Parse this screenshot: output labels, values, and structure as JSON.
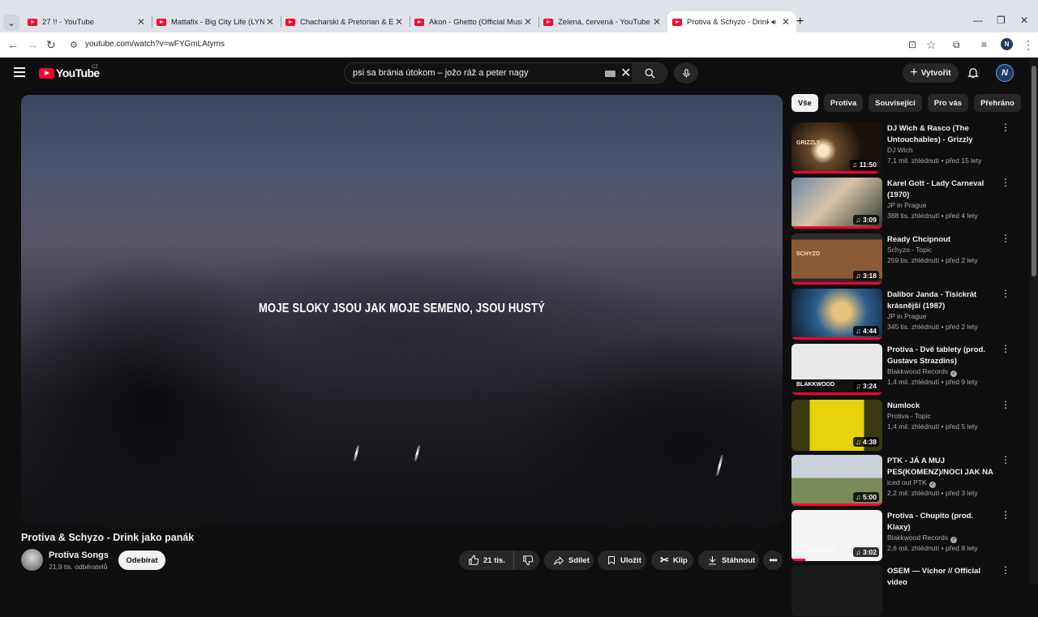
{
  "browser": {
    "tabs": [
      {
        "title": "27 !! - YouTube",
        "active": false,
        "audio": false
      },
      {
        "title": "Mattafix - Big City Life (LYNE Dr",
        "active": false,
        "audio": false
      },
      {
        "title": "Chacharski & Pretorian & El Ba",
        "active": false,
        "audio": false
      },
      {
        "title": "Akon - Ghetto (Official Music V",
        "active": false,
        "audio": false
      },
      {
        "title": "Zelená, červená - YouTube",
        "active": false,
        "audio": false
      },
      {
        "title": "Protiva & Schyzo - Drink jak",
        "active": true,
        "audio": true
      }
    ],
    "url": "youtube.com/watch?v=wFYGmLAtyms"
  },
  "masthead": {
    "logo_text": "YouTube",
    "country_code": "CZ",
    "search_value": "psi sa bránia útokom – jožo ráž a peter nagy",
    "create_label": "Vytvořit",
    "avatar_letter": "N"
  },
  "player": {
    "subtitle": "MOJE SLOKY JSOU JAK MOJE SEMENO, JSOU HUSTÝ"
  },
  "video": {
    "title": "Protiva & Schyzo - Drink jako panák",
    "channel": "Protiva Songs",
    "subscribers": "21,9 tis. odběratelů",
    "subscribe_label": "Odebírat",
    "likes": "21 tis.",
    "share_label": "Sdílet",
    "save_label": "Uložit",
    "clip_label": "Klip",
    "download_label": "Stáhnout"
  },
  "chips": [
    "Vše",
    "Protiva",
    "Související",
    "Pro vás",
    "Přehráno"
  ],
  "recommendations": [
    {
      "title": "DJ Wich & Rasco (The Untouchables) - Grizzly (CZ/S...",
      "channel": "DJ Wich",
      "verified": false,
      "views": "7,1 mil. zhlédnutí",
      "age": "před 15 lety",
      "duration": "11:50",
      "progress": 0.95,
      "thumb_text": "GRIZZLY"
    },
    {
      "title": "Karel Gott - Lady Carneval (1970)",
      "channel": "JP in Prague",
      "verified": false,
      "views": "388 tis. zhlédnutí",
      "age": "před 4 lety",
      "duration": "3:09",
      "progress": 1.0,
      "thumb_text": ""
    },
    {
      "title": "Ready Chcipnout",
      "channel": "Schyzo - Topic",
      "verified": false,
      "views": "259 tis. zhlédnutí",
      "age": "před 2 lety",
      "duration": "3:18",
      "progress": 1.0,
      "thumb_text": "SCHYZO"
    },
    {
      "title": "Dalibor Janda - Tisíckrát krásnější (1987)",
      "channel": "JP in Prague",
      "verified": false,
      "views": "345 tis. zhlédnutí",
      "age": "před 2 lety",
      "duration": "4:44",
      "progress": 1.0,
      "thumb_text": ""
    },
    {
      "title": "Protiva - Dvě tablety (prod. Gustavs Strazdins)",
      "channel": "Blakkwood Records",
      "verified": true,
      "views": "1,4 mil. zhlédnutí",
      "age": "před 9 lety",
      "duration": "3:24",
      "progress": 1.0,
      "thumb_text": "BLAKKWOOD"
    },
    {
      "title": "Numlock",
      "channel": "Protiva - Topic",
      "verified": false,
      "views": "1,4 mil. zhlédnutí",
      "age": "před 5 lety",
      "duration": "4:38",
      "progress": 0,
      "thumb_text": ""
    },
    {
      "title": "PTK - JÁ A MUJ PES(KOMENZ)/NOCI JAK NA ...",
      "channel": "iced out PTK",
      "verified": true,
      "views": "2,2 mil. zhlédnutí",
      "age": "před 3 lety",
      "duration": "5:00",
      "progress": 1.0,
      "thumb_text": ""
    },
    {
      "title": "Protiva - Chupito (prod. Klaxy)",
      "channel": "Blakkwood Records",
      "verified": true,
      "views": "2,6 mil. zhlédnutí",
      "age": "před 8 lety",
      "duration": "3:02",
      "progress": 0.15,
      "thumb_text": "BLAKKWOOD"
    },
    {
      "title": "OSEM — Víchor // Official video",
      "channel": "",
      "verified": false,
      "views": "",
      "age": "",
      "duration": "",
      "progress": 0,
      "thumb_text": ""
    }
  ],
  "colors": {
    "accent": "#ff0033",
    "page_bg": "#0f0f0f",
    "pill_bg": "#272727"
  }
}
